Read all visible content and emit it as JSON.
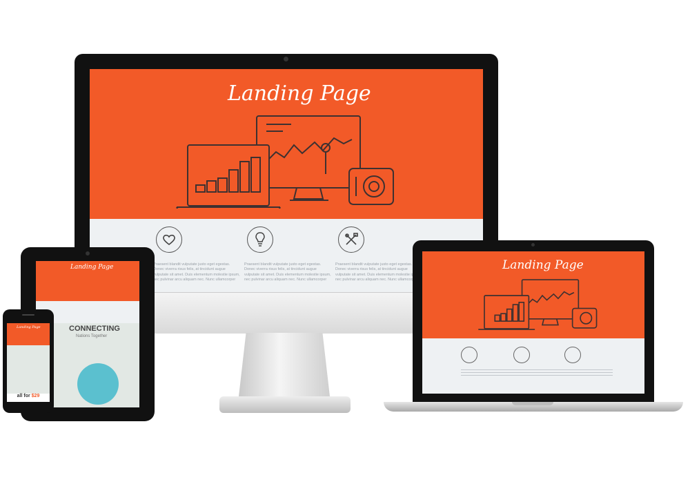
{
  "monitor": {
    "title": "Landing Page",
    "features": [
      {
        "icon": "heart-icon",
        "text": "Praesent blandit vulputate justo eget egestas. Donec viverra risus felis, at tincidunt augue vulputate sit amet. Duis elementum molestie ipsum, nec pulvinar arcu aliquam nec. Nunc ullamcorper"
      },
      {
        "icon": "lightbulb-icon",
        "text": "Praesent blandit vulputate justo eget egestas. Donec viverra risus felis, at tincidunt augue vulputate sit amet. Duis elementum molestie ipsum, nec pulvinar arcu aliquam nec. Nunc ullamcorper"
      },
      {
        "icon": "tools-icon",
        "text": "Praesent blandit vulputate justo eget egestas. Donec viverra risus felis, at tincidunt augue vulputate sit amet. Duis elementum molestie ipsum, nec pulvinar arcu aliquam nec. Nunc ullamcorper"
      }
    ]
  },
  "laptop": {
    "title": "Landing Page"
  },
  "tablet": {
    "title": "Landing Page",
    "heading": "CONNECTING",
    "subheading": "Nations Together"
  },
  "phone": {
    "title": "Landing Page",
    "price_prefix": "all for",
    "price": "$29"
  },
  "colors": {
    "accent": "#f25a28",
    "light_panel": "#eef1f3",
    "line_art": "#3d3131"
  }
}
